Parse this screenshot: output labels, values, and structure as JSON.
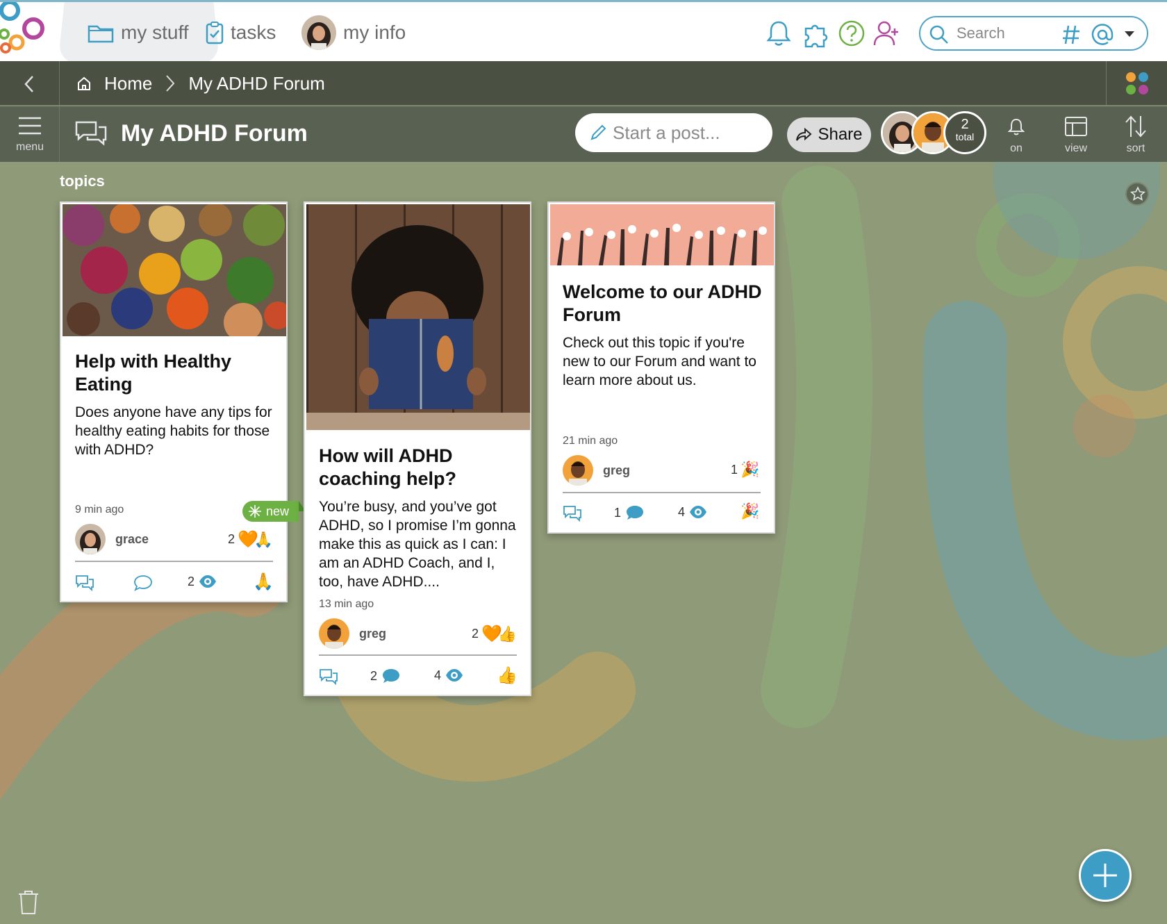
{
  "nav": {
    "my_stuff": "my stuff",
    "tasks": "tasks",
    "my_info": "my info"
  },
  "search": {
    "placeholder": "Search"
  },
  "breadcrumb": {
    "home": "Home",
    "current": "My ADHD Forum"
  },
  "titlebar": {
    "menu_label": "menu",
    "title": "My ADHD Forum",
    "start_post": "Start a post...",
    "share": "Share",
    "members_count": "2",
    "members_label": "total",
    "notify_label": "on",
    "view_label": "view",
    "sort_label": "sort"
  },
  "section_label": "topics",
  "cards": [
    {
      "title": "Help with Healthy Eating",
      "excerpt": "Does anyone have any tips for healthy eating habits for those with ADHD?",
      "time": "9 min ago",
      "author": "grace",
      "reaction_count": "2",
      "badge": "new",
      "views": "2",
      "image": "food-image"
    },
    {
      "title": "How will ADHD coaching help?",
      "excerpt": "You’re busy, and you’ve got ADHD, so I promise I’m gonna make this as quick as I can: I am an ADHD Coach, and I, too, have ADHD....",
      "time": "13 min ago",
      "author": "greg",
      "reaction_count": "2",
      "comments": "2",
      "views": "4",
      "image": "reading-woman-image"
    },
    {
      "title": "Welcome to our ADHD Forum",
      "excerpt": "Check out this topic if you're new to our Forum and want to learn more about us.",
      "time": "21 min ago",
      "author": "greg",
      "reaction_count": "1",
      "comments": "1",
      "views": "4",
      "image": "raised-hands-banner"
    }
  ],
  "colors": {
    "accent": "#3d9dc4",
    "header_dark": "#4a5143",
    "titlebar": "#596152",
    "canvas": "#8f9a78",
    "new_badge": "#6db043"
  }
}
